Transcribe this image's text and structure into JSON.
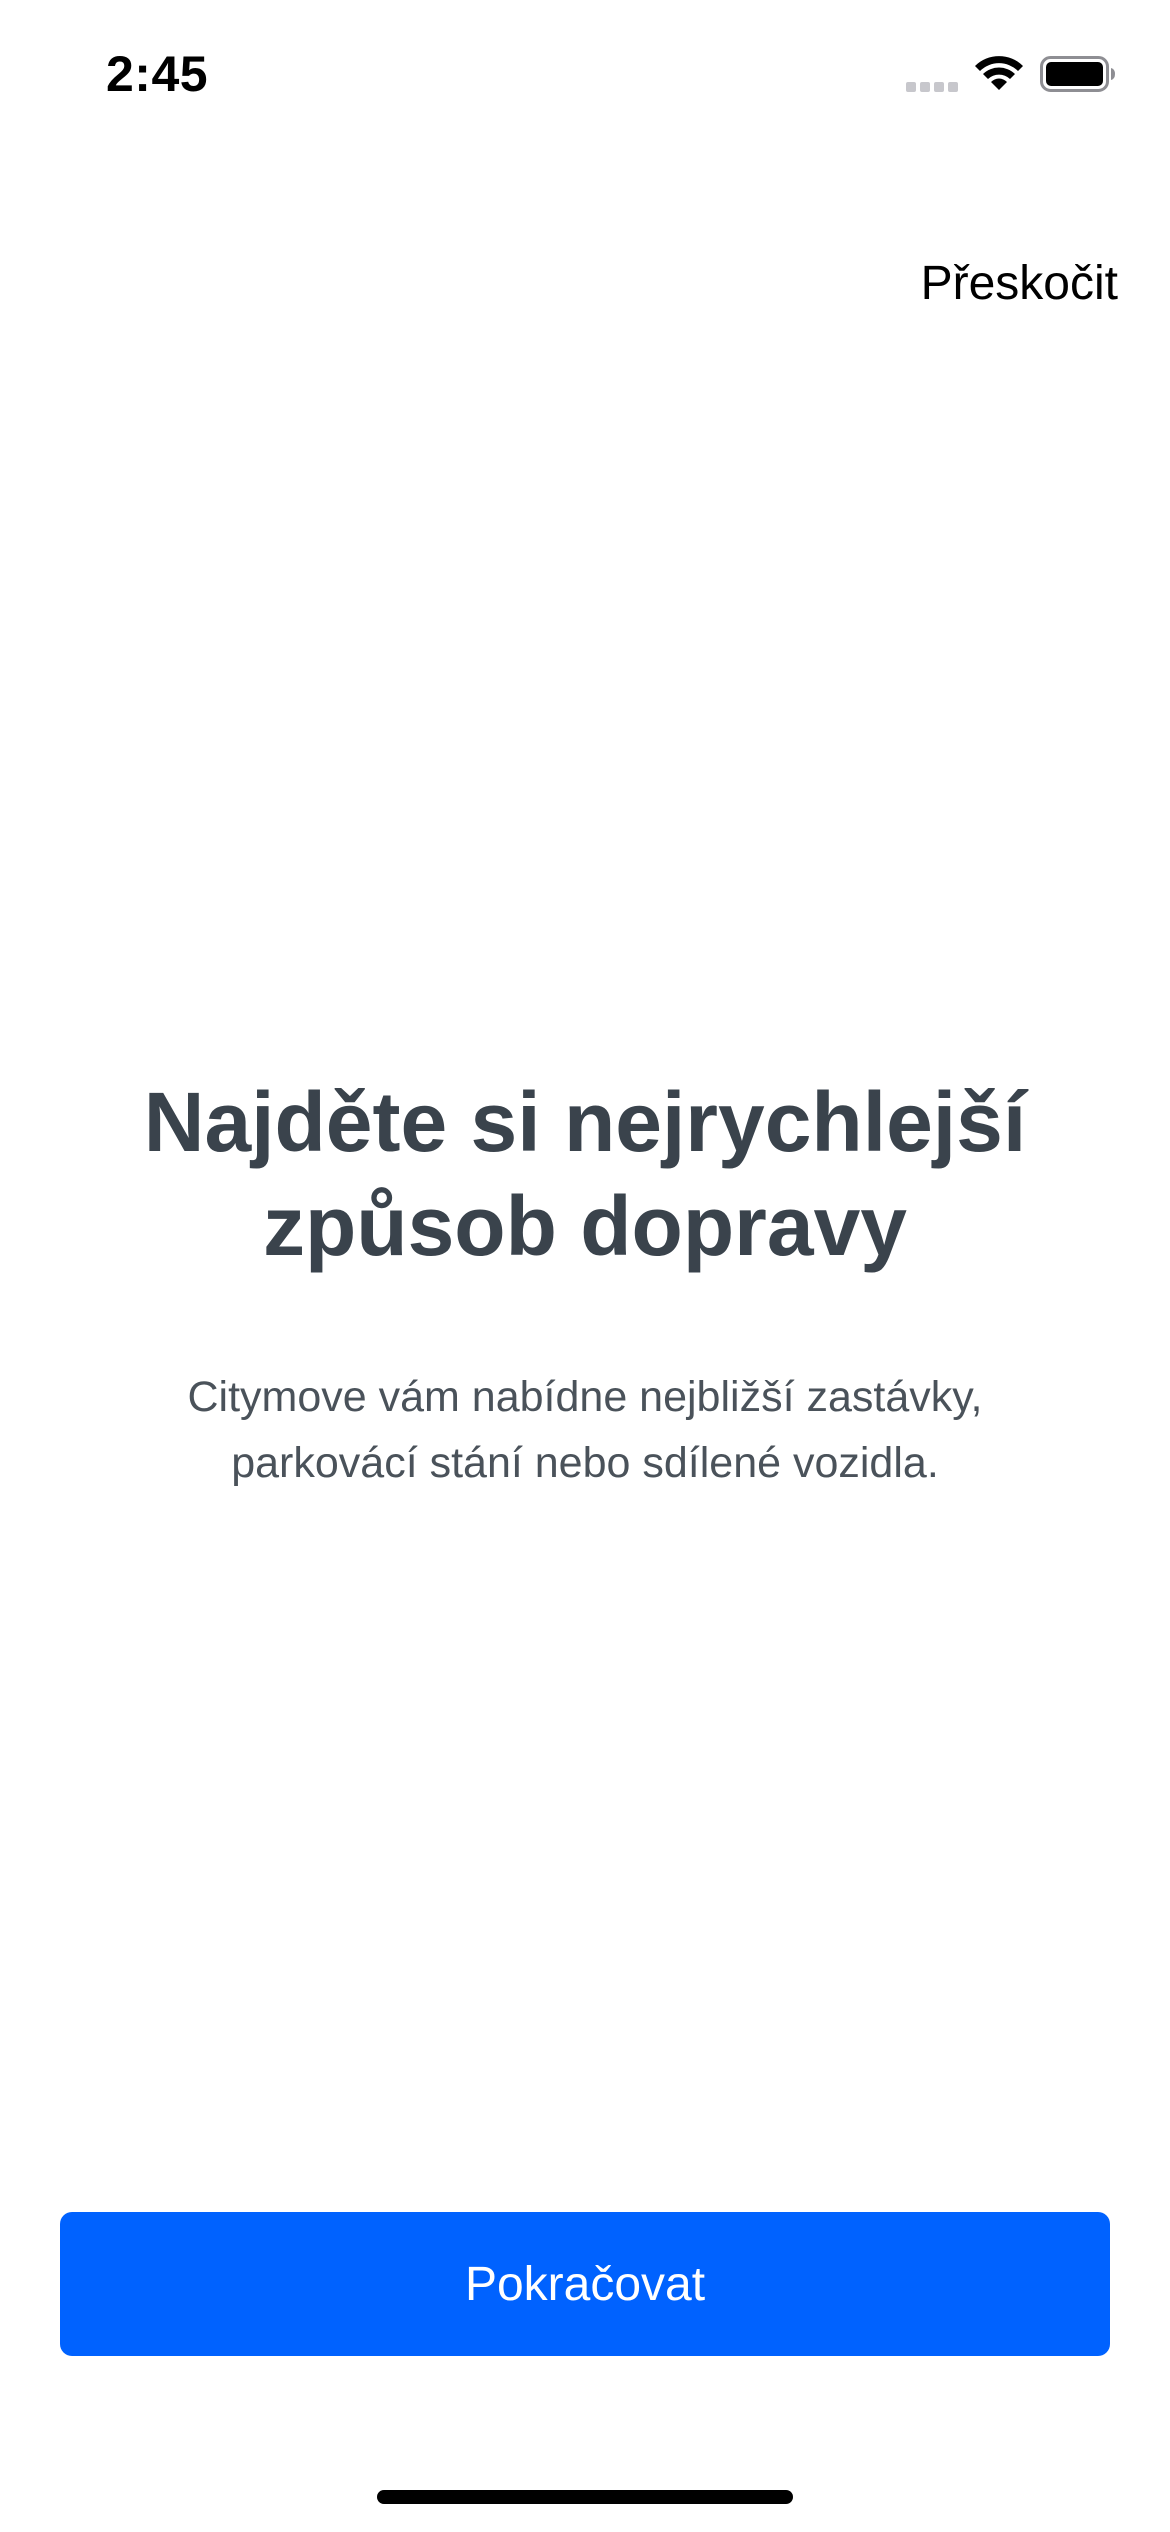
{
  "status_bar": {
    "time": "2:45"
  },
  "header": {
    "skip_label": "Přeskočit"
  },
  "onboarding": {
    "title_line1": "Najděte si nejrychlejší",
    "title_line2": "způsob dopravy",
    "subtitle_line1": "Citymove vám nabídne nejbližší zastávky,",
    "subtitle_line2": "parkovácí stání nebo sdílené vozidla."
  },
  "footer": {
    "continue_label": "Pokračovat"
  },
  "colors": {
    "primary": "#0062ff",
    "title_text": "#3a434c",
    "body_text": "#4a525a"
  },
  "icons": [
    "cellular-signal-icon",
    "wifi-icon",
    "battery-icon"
  ]
}
